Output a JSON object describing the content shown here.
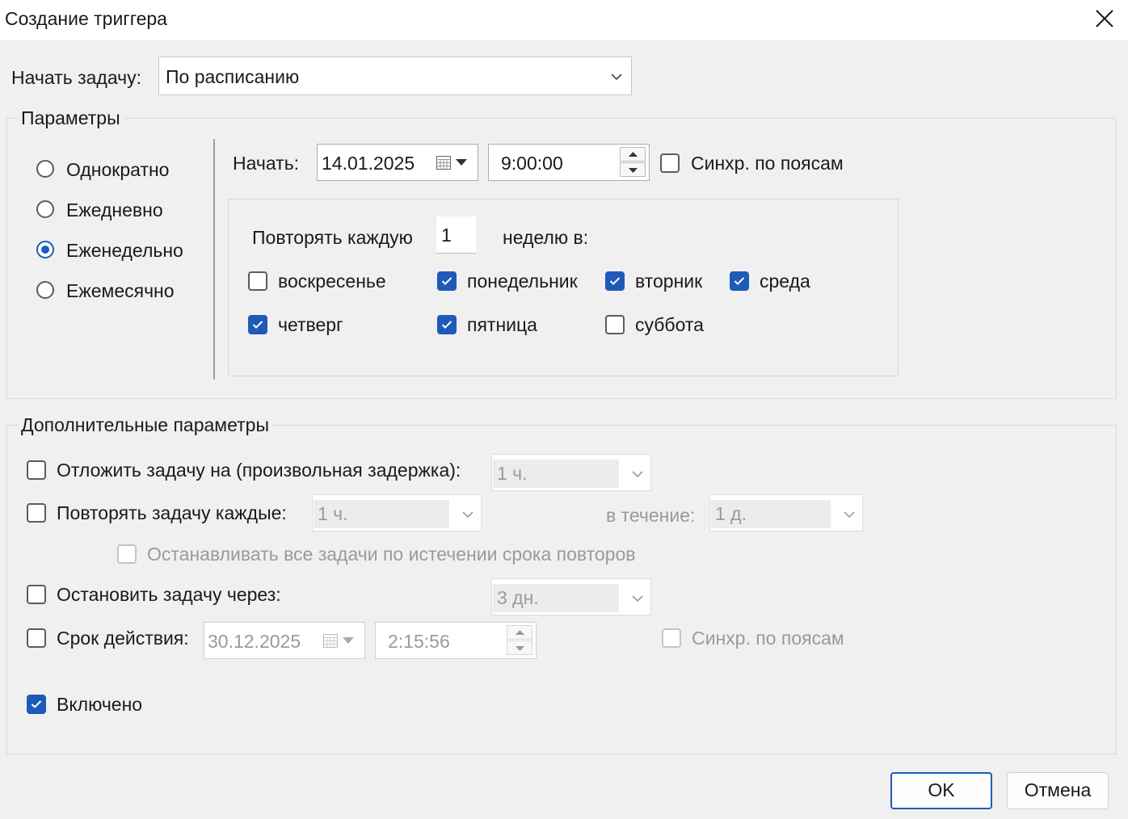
{
  "window": {
    "title": "Создание триггера"
  },
  "start_task": {
    "label": "Начать задачу:",
    "value": "По расписанию"
  },
  "params": {
    "legend": "Параметры",
    "schedule_options": [
      {
        "label": "Однократно",
        "selected": false
      },
      {
        "label": "Ежедневно",
        "selected": false
      },
      {
        "label": "Еженедельно",
        "selected": true
      },
      {
        "label": "Ежемесячно",
        "selected": false
      }
    ],
    "start_label": "Начать:",
    "start_date": "14.01.2025",
    "start_time": "9:00:00",
    "sync_tz_label": "Синхр. по поясам",
    "sync_tz_checked": false,
    "repeat_every_label": "Повторять каждую",
    "repeat_every_value": "1",
    "weeks_on_label": "неделю в:",
    "days": [
      {
        "label": "воскресенье",
        "checked": false
      },
      {
        "label": "понедельник",
        "checked": true
      },
      {
        "label": "вторник",
        "checked": true
      },
      {
        "label": "среда",
        "checked": true
      },
      {
        "label": "четверг",
        "checked": true
      },
      {
        "label": "пятница",
        "checked": true
      },
      {
        "label": "суббота",
        "checked": false
      }
    ]
  },
  "advanced": {
    "legend": "Дополнительные параметры",
    "delay": {
      "label": "Отложить задачу на (произвольная задержка):",
      "value": "1 ч.",
      "checked": false
    },
    "repeat": {
      "label": "Повторять задачу каждые:",
      "value": "1 ч.",
      "checked": false,
      "duration_label": "в течение:",
      "duration_value": "1 д."
    },
    "stop_all": {
      "label": "Останавливать все задачи по истечении срока повторов",
      "checked": false
    },
    "stop_after": {
      "label": "Остановить задачу через:",
      "value": "3 дн.",
      "checked": false
    },
    "expire": {
      "label": "Срок действия:",
      "date": "30.12.2025",
      "time": "2:15:56",
      "checked": false,
      "sync_label": "Синхр. по поясам",
      "sync_checked": false
    },
    "enabled": {
      "label": "Включено",
      "checked": true
    }
  },
  "buttons": {
    "ok": "OK",
    "cancel": "Отмена"
  },
  "colors": {
    "accent": "#1e5bb8",
    "background": "#f0f0f0"
  }
}
